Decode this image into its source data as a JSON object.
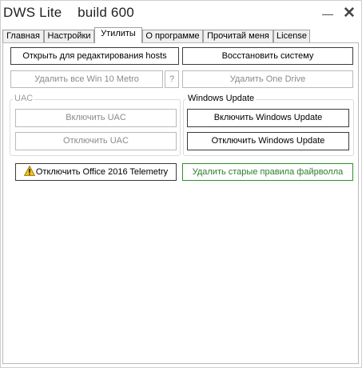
{
  "window": {
    "title": "DWS Lite    build 600",
    "minimize_glyph": "—",
    "close_glyph": "✕"
  },
  "tabs": [
    {
      "label": "Главная"
    },
    {
      "label": "Настройки"
    },
    {
      "label": "Утилиты",
      "active": true
    },
    {
      "label": "О программе"
    },
    {
      "label": "Прочитай меня"
    },
    {
      "label": "License"
    }
  ],
  "utilities": {
    "open_hosts": "Открыть для редактирования hosts",
    "restore_system": "Восстановить систему",
    "remove_metro": "Удалить все Win 10 Metro",
    "metro_help": "?",
    "remove_onedrive": "Удалить One Drive",
    "office_telemetry": "Отключить Office 2016 Telemetry",
    "remove_firewall_rules": "Удалить старые правила файрволла"
  },
  "uac": {
    "legend": "UAC",
    "enable": "Включить UAC",
    "disable": "Отключить UAC"
  },
  "windows_update": {
    "legend": "Windows Update",
    "enable": "Включить Windows Update",
    "disable": "Отключить Windows Update"
  },
  "icons": {
    "warning": "warning-icon"
  },
  "colors": {
    "green_button": "#2d8f2d",
    "disabled_text": "#8a8a8a",
    "warning_yellow": "#f3c11b"
  }
}
